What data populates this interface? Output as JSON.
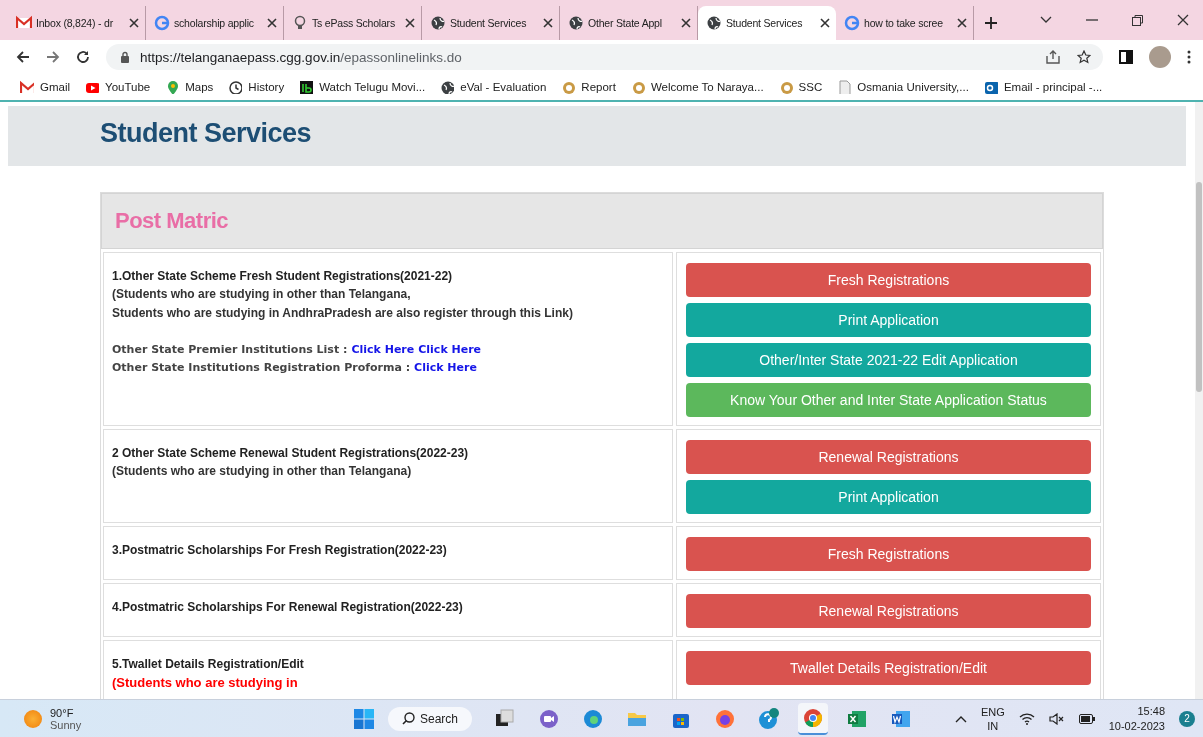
{
  "tabs": [
    {
      "title": "Inbox (8,824) - dr",
      "selected": false
    },
    {
      "title": "scholarship applic",
      "selected": false
    },
    {
      "title": "Ts ePass Scholars",
      "selected": false
    },
    {
      "title": "Student Services",
      "selected": false
    },
    {
      "title": "Other State Appl",
      "selected": false
    },
    {
      "title": "Student Services",
      "selected": true
    },
    {
      "title": "how to take scree",
      "selected": false
    }
  ],
  "address": {
    "host": "https://telanganaepass.cgg.gov.in",
    "path": "/epassonlinelinks.do"
  },
  "bookmarks": [
    "Gmail",
    "YouTube",
    "Maps",
    "History",
    "Watch Telugu Movi...",
    "eVal - Evaluation",
    "Report",
    "Welcome To Naraya...",
    "SSC",
    "Osmania University,...",
    "Email - principal -..."
  ],
  "page": {
    "title": "Student Services",
    "section": "Post Matric",
    "rows": [
      {
        "title": "1.Other State Scheme Fresh Student Registrations(2021-22)",
        "notes": [
          {
            "text": "(Students who are studying in other than Telangana,",
            "kind": "plain"
          },
          {
            "text": "Students who are studying in AndhraPradesh are also register through this Link)",
            "kind": "plain"
          }
        ],
        "links": [
          {
            "label": "Other State Premier Institutions List :",
            "links": [
              "Click Here",
              "Click Here"
            ]
          },
          {
            "label": "Other State Institutions Registration Proforma :",
            "links": [
              "Click Here"
            ]
          }
        ],
        "buttons": [
          {
            "label": "Fresh Registrations",
            "kind": "danger"
          },
          {
            "label": "Print Application",
            "kind": "info"
          },
          {
            "label": "Other/Inter State 2021-22 Edit Application",
            "kind": "info"
          },
          {
            "label": "Know Your Other and Inter State Application Status",
            "kind": "success"
          }
        ]
      },
      {
        "title": "2 Other State Scheme Renewal Student Registrations(2022-23)",
        "notes": [
          {
            "text": "(Students who are studying in other than Telangana)",
            "kind": "plain"
          }
        ],
        "buttons": [
          {
            "label": "Renewal Registrations",
            "kind": "danger"
          },
          {
            "label": "Print Application",
            "kind": "info"
          }
        ]
      },
      {
        "title": "3.Postmatric Scholarships For Fresh Registration(2022-23)",
        "buttons": [
          {
            "label": "Fresh Registrations",
            "kind": "danger"
          }
        ]
      },
      {
        "title": "4.Postmatric Scholarships For Renewal Registration(2022-23)",
        "buttons": [
          {
            "label": "Renewal Registrations",
            "kind": "danger"
          }
        ]
      },
      {
        "title": "5.Twallet Details Registration/Edit",
        "notes": [
          {
            "text": "(Students who are studying in",
            "kind": "alert"
          }
        ],
        "buttons": [
          {
            "label": "Twallet Details Registration/Edit",
            "kind": "danger"
          }
        ]
      }
    ]
  },
  "taskbar": {
    "weather": {
      "temp": "90°F",
      "condition": "Sunny"
    },
    "search": "Search",
    "apps": [
      {
        "active": false
      },
      {
        "active": false
      },
      {
        "active": false
      },
      {
        "active": false
      },
      {
        "active": false
      },
      {
        "active": false
      },
      {
        "active": false
      },
      {
        "active": true
      },
      {
        "active": false
      },
      {
        "active": false
      }
    ],
    "lang": [
      "ENG",
      "IN"
    ],
    "time": "15:48",
    "date": "10-02-2023",
    "badge": "2"
  }
}
